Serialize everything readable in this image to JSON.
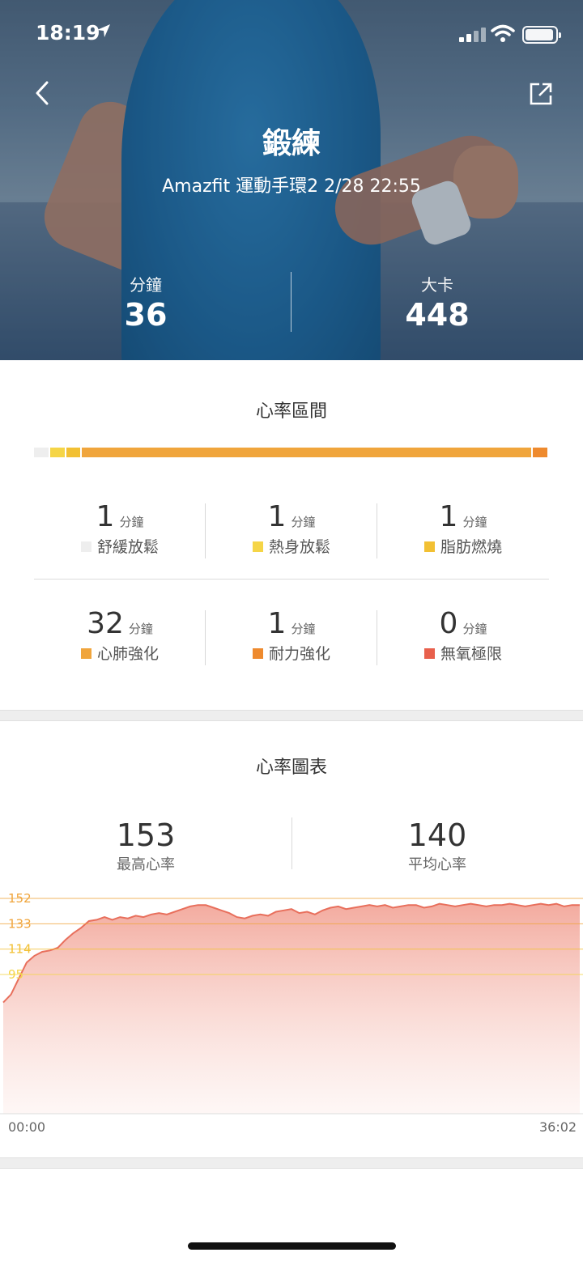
{
  "status_bar": {
    "time": "18:19"
  },
  "header": {
    "title": "鍛練",
    "subtitle": "Amazfit 運動手環2 2/28 22:55",
    "stats": [
      {
        "label": "分鐘",
        "value": "36"
      },
      {
        "label": "大卡",
        "value": "448"
      }
    ]
  },
  "zones": {
    "title": "心率區間",
    "unit": "分鐘",
    "items": [
      {
        "value": "1",
        "name": "舒緩放鬆",
        "color": "#eeeeee"
      },
      {
        "value": "1",
        "name": "熱身放鬆",
        "color": "#f5d547"
      },
      {
        "value": "1",
        "name": "脂肪燃燒",
        "color": "#f2c033"
      },
      {
        "value": "32",
        "name": "心肺強化",
        "color": "#f0a53c"
      },
      {
        "value": "1",
        "name": "耐力強化",
        "color": "#ee8a2e"
      },
      {
        "value": "0",
        "name": "無氧極限",
        "color": "#e8604c"
      }
    ]
  },
  "heart_chart": {
    "title": "心率圖表",
    "max": {
      "value": "153",
      "label": "最高心率"
    },
    "avg": {
      "value": "140",
      "label": "平均心率"
    },
    "time_start": "00:00",
    "time_end": "36:02"
  },
  "chart_data": {
    "type": "area",
    "title": "心率圖表",
    "x_range": [
      "00:00",
      "36:02"
    ],
    "threshold_lines": [
      {
        "value": 152,
        "label": "152",
        "color": "#f0a53c"
      },
      {
        "value": 133,
        "label": "133",
        "color": "#f0a53c"
      },
      {
        "value": 114,
        "label": "114",
        "color": "#f2c033"
      },
      {
        "value": 95,
        "label": "95",
        "color": "#f5d547"
      }
    ],
    "ylim": [
      40,
      160
    ],
    "series": [
      {
        "values": [
          74,
          80,
          92,
          104,
          109,
          112,
          113,
          115,
          121,
          126,
          130,
          135,
          136,
          138,
          136,
          138,
          137,
          139,
          138,
          140,
          141,
          140,
          142,
          144,
          146,
          147,
          147,
          145,
          143,
          141,
          138,
          137,
          139,
          140,
          139,
          142,
          143,
          144,
          141,
          142,
          140,
          143,
          145,
          146,
          144,
          145,
          146,
          147,
          146,
          147,
          145,
          146,
          147,
          147,
          145,
          146,
          148,
          147,
          146,
          147,
          148,
          147,
          146,
          147,
          147,
          148,
          147,
          146,
          147,
          148,
          147,
          148,
          146,
          147,
          147
        ]
      }
    ]
  }
}
